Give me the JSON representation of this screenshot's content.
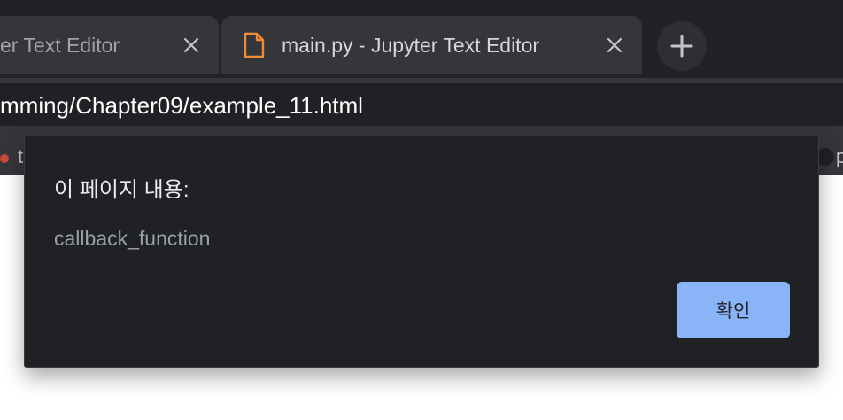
{
  "tabs": [
    {
      "title": "er Text Editor",
      "close_icon": "close-icon"
    },
    {
      "title": "main.py - Jupyter Text Editor",
      "icon": "file-icon",
      "icon_color": "#f28b36",
      "close_icon": "close-icon"
    }
  ],
  "new_tab": {
    "icon": "plus-icon"
  },
  "address_bar": {
    "url": "mming/Chapter09/example_11.html"
  },
  "bookmarks": {
    "left_label": "t",
    "right_label": "p"
  },
  "dialog": {
    "title": "이 페이지 내용:",
    "message": "callback_function",
    "ok_label": "확인",
    "accent": "#8ab4f8"
  },
  "colors": {
    "tabstrip": "#202227",
    "tab": "#35363a",
    "dialog_bg": "#202124",
    "page_bg": "#ffffff"
  }
}
